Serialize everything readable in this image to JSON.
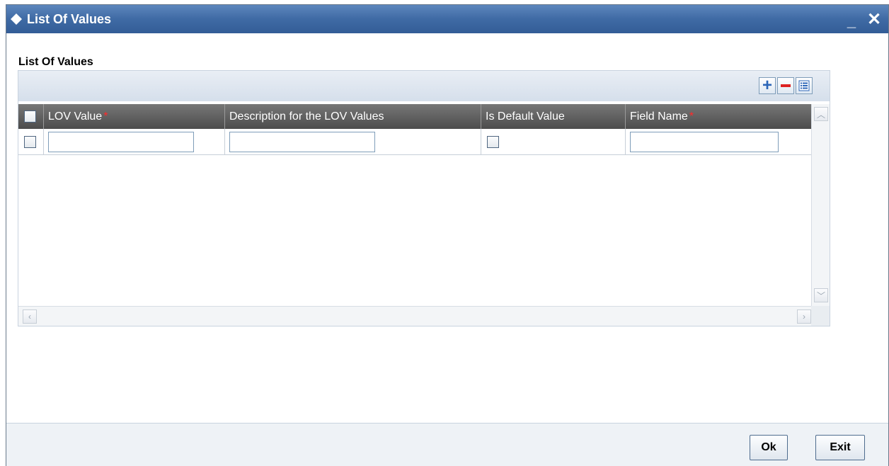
{
  "window": {
    "title": "List Of Values",
    "minimize_glyph": "_",
    "close_glyph": "✕"
  },
  "section": {
    "label": "List Of Values"
  },
  "toolbar": {
    "add_icon": "plus-icon",
    "delete_icon": "minus-icon",
    "view_icon": "list-view-icon",
    "add_glyph": "+"
  },
  "table": {
    "columns": [
      {
        "label": "LOV Value",
        "required": true
      },
      {
        "label": "Description for the LOV Values",
        "required": false
      },
      {
        "label": "Is Default Value",
        "required": false
      },
      {
        "label": "Field Name",
        "required": true
      }
    ],
    "required_marker": "*",
    "rows": [
      {
        "lov_value": "",
        "description": "",
        "is_default": false,
        "field_name": ""
      }
    ]
  },
  "scroll": {
    "up": "︿",
    "down": "﹀",
    "left": "‹",
    "right": "›"
  },
  "footer": {
    "ok_label": "Ok",
    "exit_label": "Exit"
  },
  "colors": {
    "titlebar": "#3f6aa4",
    "header": "#5a5a5a",
    "required": "#ff2a2a",
    "delete_icon": "#dd2222"
  }
}
